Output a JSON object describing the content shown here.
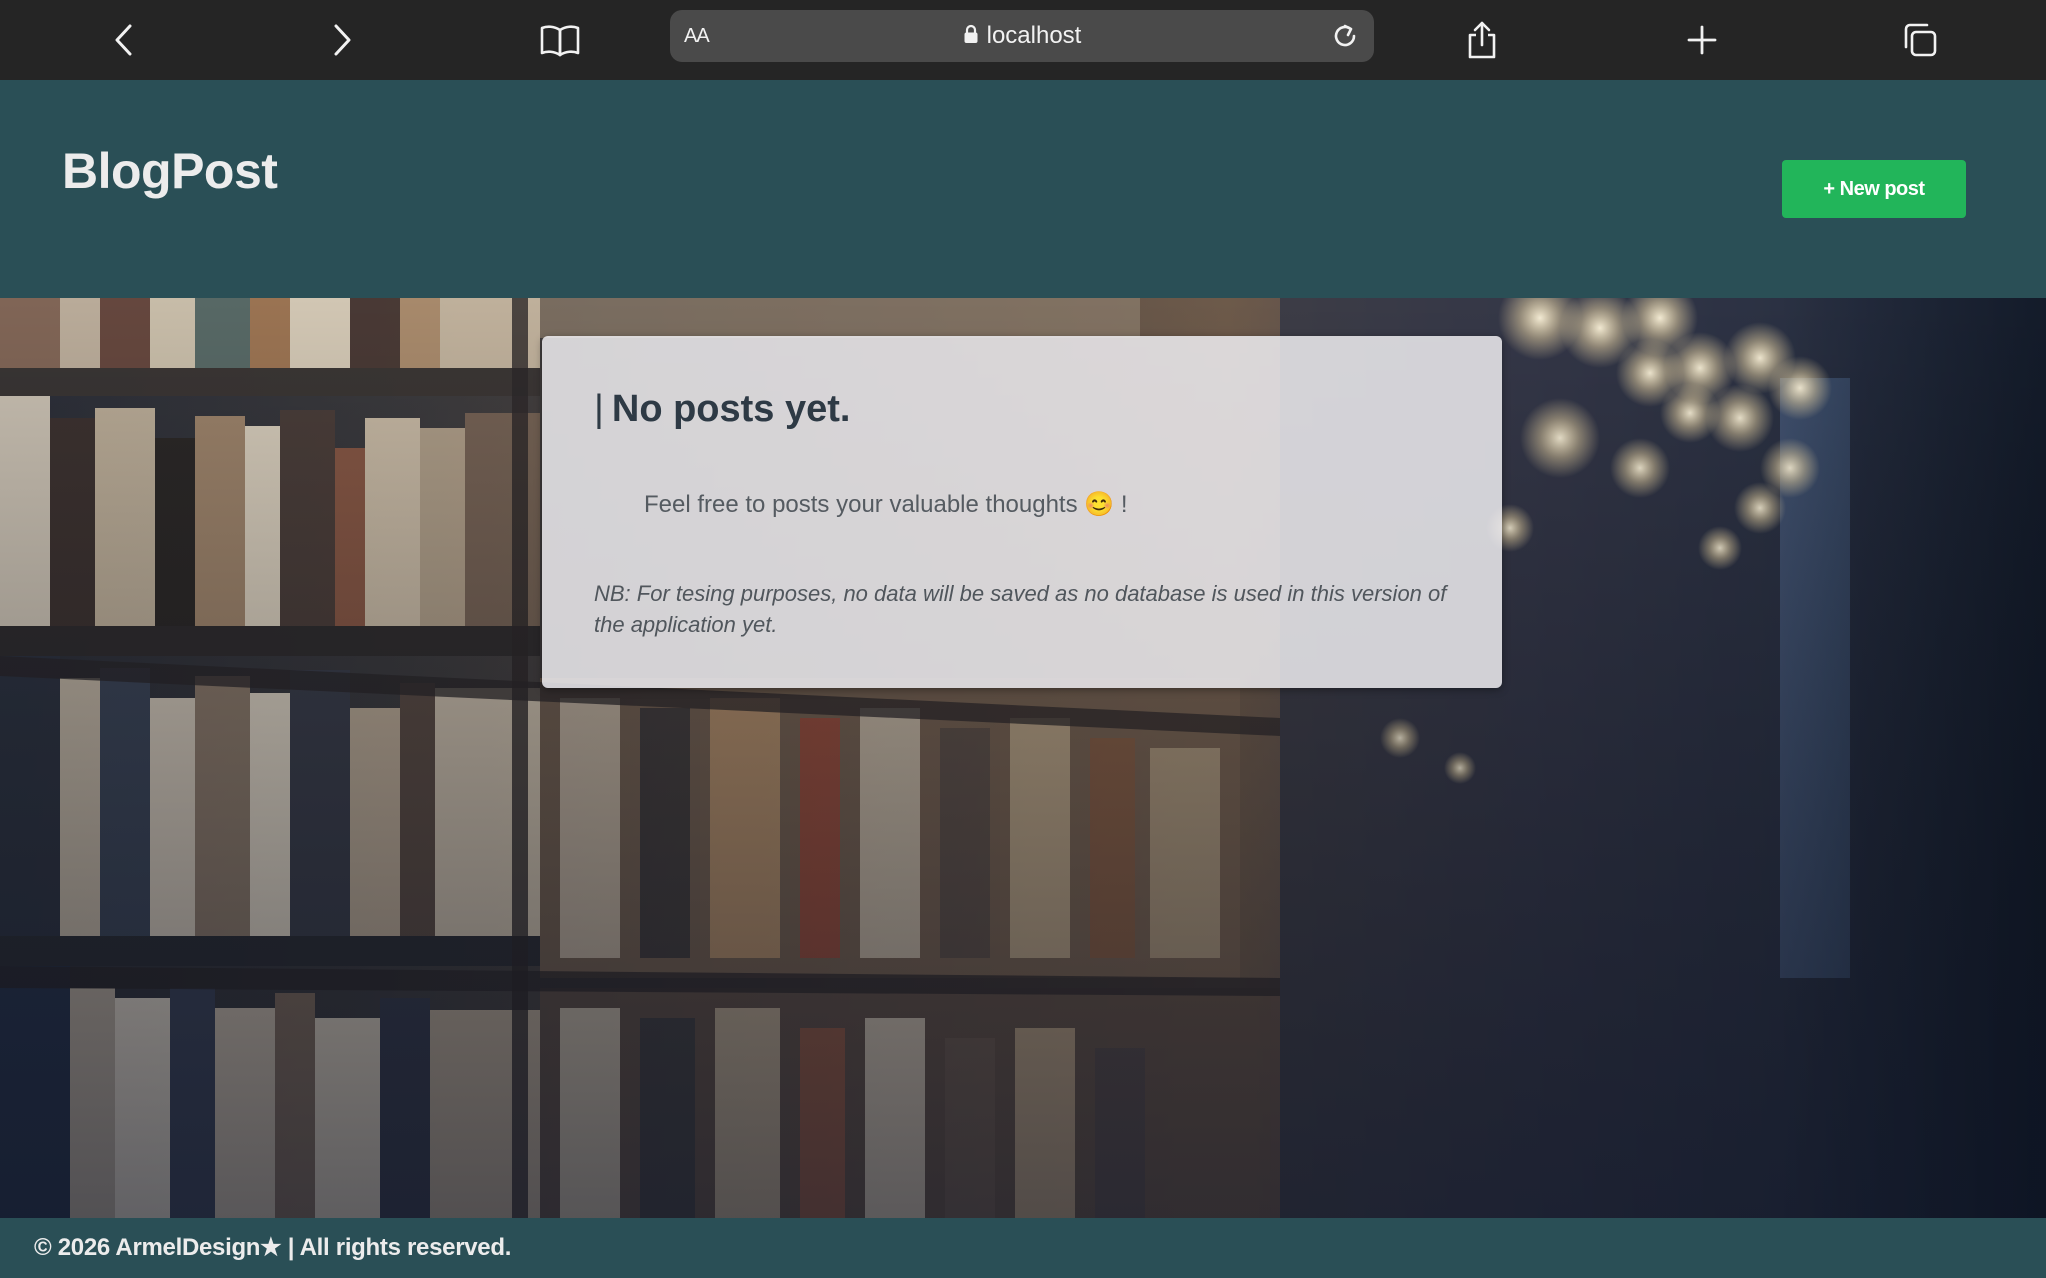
{
  "browser": {
    "text_size_label": "AA",
    "url": "localhost",
    "icons": {
      "back": "chevron-left-icon",
      "forward": "chevron-right-icon",
      "bookmarks": "book-icon",
      "lock": "lock-icon",
      "reload": "reload-icon",
      "share": "share-icon",
      "new_tab": "plus-icon",
      "tabs": "tabs-icon"
    }
  },
  "header": {
    "brand": "BlogPost",
    "new_post_label": "+ New post",
    "accent_color": "#22b55a",
    "background_color": "#2a4f56"
  },
  "card": {
    "title": "No posts yet.",
    "title_marker": "|",
    "subtitle": "Feel free to posts your valuable thoughts 😊 !",
    "note": "NB: For tesing purposes, no data will be saved as no database is used in this version of the application yet."
  },
  "footer": {
    "text": "© 2026 ArmelDesign★ | All rights reserved."
  }
}
